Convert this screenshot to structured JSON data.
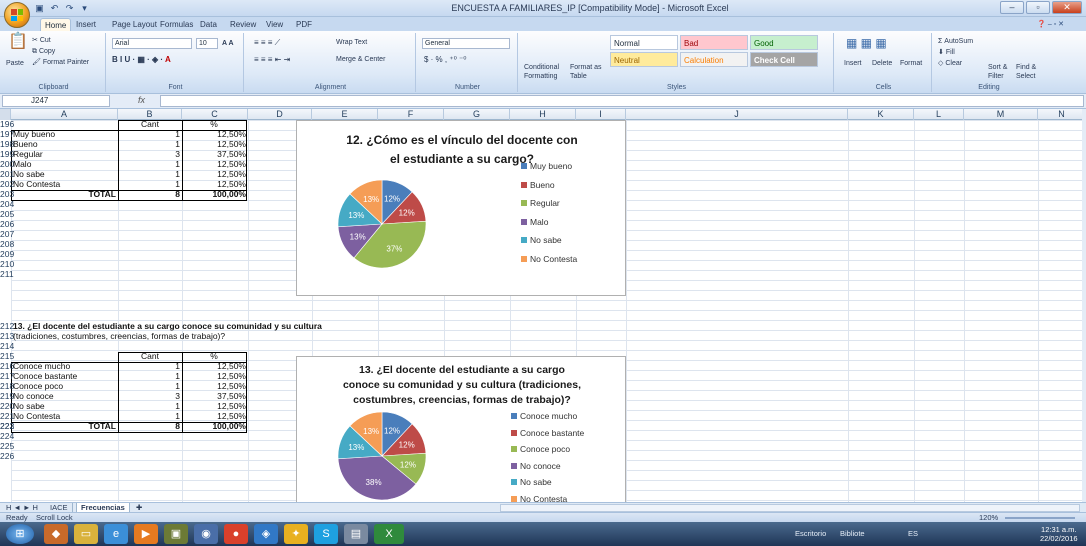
{
  "window": {
    "title": "ENCUESTA A FAMILIARES_IP  [Compatibility Mode] - Microsoft Excel"
  },
  "tabs": [
    "Home",
    "Insert",
    "Page Layout",
    "Formulas",
    "Data",
    "Review",
    "View",
    "PDF"
  ],
  "ribbon": {
    "clipboard": {
      "label": "Clipboard",
      "paste": "Paste",
      "cut": "Cut",
      "copy": "Copy",
      "format_painter": "Format Painter"
    },
    "font": {
      "label": "Font",
      "name": "Arial",
      "size": "10"
    },
    "alignment": {
      "label": "Alignment",
      "wrap": "Wrap Text",
      "merge": "Merge & Center"
    },
    "number": {
      "label": "Number",
      "format": "General"
    },
    "styles": {
      "label": "Styles",
      "conditional": "Conditional Formatting",
      "format_table": "Format as Table",
      "normal": "Normal",
      "bad": "Bad",
      "good": "Good",
      "neutral": "Neutral",
      "calculation": "Calculation",
      "check_cell": "Check Cell"
    },
    "cells": {
      "label": "Cells",
      "insert": "Insert",
      "delete": "Delete",
      "format": "Format"
    },
    "editing": {
      "label": "Editing",
      "autosum": "AutoSum",
      "fill": "Fill",
      "clear": "Clear",
      "sort": "Sort & Filter",
      "find": "Find & Select"
    }
  },
  "formula_bar": {
    "name_box": "J247",
    "fx": "fx"
  },
  "columns": [
    "A",
    "B",
    "C",
    "D",
    "E",
    "F",
    "G",
    "H",
    "I",
    "J",
    "K",
    "L",
    "M",
    "N"
  ],
  "table1": {
    "header_row": "196",
    "col_cant": "Cant",
    "col_pct": "%",
    "rows": [
      {
        "n": "197",
        "label": "Muy bueno",
        "cant": "1",
        "pct": "12,50%"
      },
      {
        "n": "198",
        "label": "Bueno",
        "cant": "1",
        "pct": "12,50%"
      },
      {
        "n": "199",
        "label": "Regular",
        "cant": "3",
        "pct": "37,50%"
      },
      {
        "n": "200",
        "label": "Malo",
        "cant": "1",
        "pct": "12,50%"
      },
      {
        "n": "201",
        "label": "No sabe",
        "cant": "1",
        "pct": "12,50%"
      },
      {
        "n": "202",
        "label": "No Contesta",
        "cant": "1",
        "pct": "12,50%"
      }
    ],
    "total": {
      "n": "203",
      "label": "TOTAL",
      "cant": "8",
      "pct": "100,00%"
    }
  },
  "empty_rows_1": [
    "204",
    "205",
    "206",
    "207",
    "208",
    "209",
    "210",
    "211"
  ],
  "question13": {
    "n1": "212",
    "line1": "13. ¿El docente del estudiante a su cargo conoce su comunidad y su cultura",
    "n2": "213",
    "line2": "(tradiciones, costumbres, creencias, formas de trabajo)?",
    "n3": "214"
  },
  "table2": {
    "header_row": "215",
    "col_cant": "Cant",
    "col_pct": "%",
    "rows": [
      {
        "n": "216",
        "label": "Conoce mucho",
        "cant": "1",
        "pct": "12,50%"
      },
      {
        "n": "217",
        "label": "Conoce bastante",
        "cant": "1",
        "pct": "12,50%"
      },
      {
        "n": "218",
        "label": "Conoce poco",
        "cant": "1",
        "pct": "12,50%"
      },
      {
        "n": "219",
        "label": "No conoce",
        "cant": "3",
        "pct": "37,50%"
      },
      {
        "n": "220",
        "label": "No sabe",
        "cant": "1",
        "pct": "12,50%"
      },
      {
        "n": "221",
        "label": "No Contesta",
        "cant": "1",
        "pct": "12,50%"
      }
    ],
    "total": {
      "n": "222",
      "label": "TOTAL",
      "cant": "8",
      "pct": "100,00%"
    }
  },
  "empty_rows_2": [
    "223",
    "224",
    "225",
    "226"
  ],
  "chart_data": [
    {
      "type": "pie",
      "title": "12. ¿Cómo es el vínculo del docente con el estudiante a su cargo?",
      "title_lines": [
        "12. ¿Cómo es el vínculo del docente con",
        "el estudiante a su cargo?"
      ],
      "categories": [
        "Muy bueno",
        "Bueno",
        "Regular",
        "Malo",
        "No sabe",
        "No Contesta"
      ],
      "values": [
        12,
        12,
        37,
        13,
        13,
        13
      ],
      "labels": [
        "12%",
        "12%",
        "37%",
        "13%",
        "13%",
        "13%"
      ],
      "colors": [
        "#4a7ebb",
        "#be4b48",
        "#98b954",
        "#7d60a0",
        "#46aac5",
        "#f59d56"
      ],
      "legend": "right"
    },
    {
      "type": "pie",
      "title": "13. ¿El docente del estudiante a su cargo conoce su comunidad y su cultura (tradiciones, costumbres, creencias, formas de trabajo)?",
      "title_lines": [
        "13. ¿El docente del estudiante a su cargo",
        "conoce su comunidad y su cultura  (tradiciones,",
        "costumbres, creencias, formas de trabajo)?"
      ],
      "categories": [
        "Conoce mucho",
        "Conoce bastante",
        "Conoce poco",
        "No conoce",
        "No sabe",
        "No Contesta"
      ],
      "values": [
        12,
        12,
        12,
        38,
        13,
        13
      ],
      "labels": [
        "12%",
        "12%",
        "12%",
        "38%",
        "13%",
        "13%"
      ],
      "colors": [
        "#4a7ebb",
        "#be4b48",
        "#98b954",
        "#7d60a0",
        "#46aac5",
        "#f59d56"
      ],
      "legend": "right"
    }
  ],
  "sheet_tabs": {
    "nav": "H ◄ ► H",
    "t1": "IACE",
    "t2": "Frecuencias"
  },
  "status": {
    "ready": "Ready",
    "scroll": "Scroll Lock",
    "zoom": "120%"
  },
  "taskbar": {
    "escritorio": "Escritorio",
    "biblioteca": "Bibliote",
    "lang": "ES",
    "time": "12:31 a.m.",
    "date": "22/02/2016"
  }
}
